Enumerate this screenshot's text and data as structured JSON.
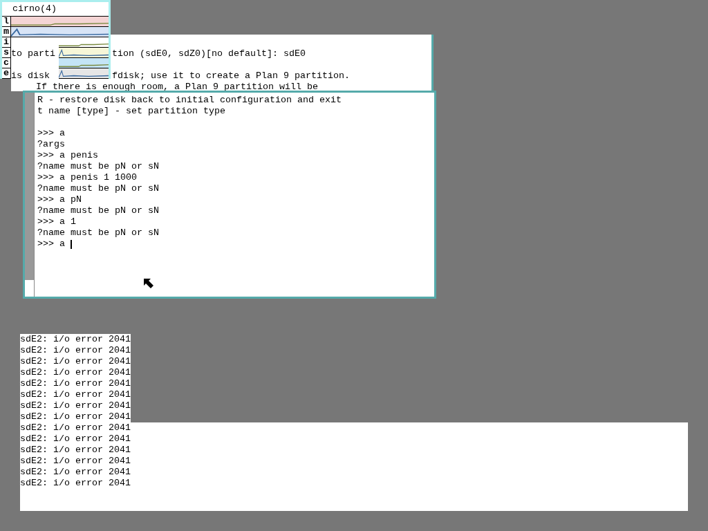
{
  "stats_window": {
    "title": "cirno(4)",
    "meters": [
      {
        "label": "l",
        "color": "#f4d4d4"
      },
      {
        "label": "m",
        "color": "#d8e4f6"
      },
      {
        "label": "i",
        "color": "#ffffff"
      },
      {
        "label": "s",
        "color": "#f6f6d8"
      },
      {
        "label": "c",
        "color": "#c4e4f6"
      },
      {
        "label": "e",
        "color": "#e6e6e6"
      }
    ]
  },
  "back_window": {
    "lines": [
      [
        "to parti",
        "tion (sdE0, sdZ0)[no default]: sdE0"
      ],
      [
        "is disk",
        "fdisk; use it to create a Plan 9 partition."
      ],
      [
        "If there is enough room, a Plan 9 partition will be"
      ]
    ]
  },
  "terminal": {
    "blocks": [
      [
        "R - restore disk back to initial configuration and exit",
        "t name [type] - set partition type"
      ],
      [
        ">>> a",
        "?args",
        ">>> a penis",
        "?name must be pN or sN",
        ">>> a penis 1 1000",
        "?name must be pN or sN",
        ">>> a pN",
        "?name must be pN or sN",
        ">>> a 1",
        "?name must be pN or sN"
      ]
    ],
    "prompt": ">>> a"
  },
  "console": {
    "lines": [
      "sdE2: i/o error 2041",
      "sdE2: i/o error 2041",
      "sdE2: i/o error 2041",
      "sdE2: i/o error 2041",
      "sdE2: i/o error 2041",
      "sdE2: i/o error 2041",
      "sdE2: i/o error 2041",
      "sdE2: i/o error 2041",
      "sdE2: i/o error 2041",
      "sdE2: i/o error 2041",
      "sdE2: i/o error 2041",
      "sdE2: i/o error 2041",
      "sdE2: i/o error 2041",
      "sdE2: i/o error 2041"
    ]
  }
}
